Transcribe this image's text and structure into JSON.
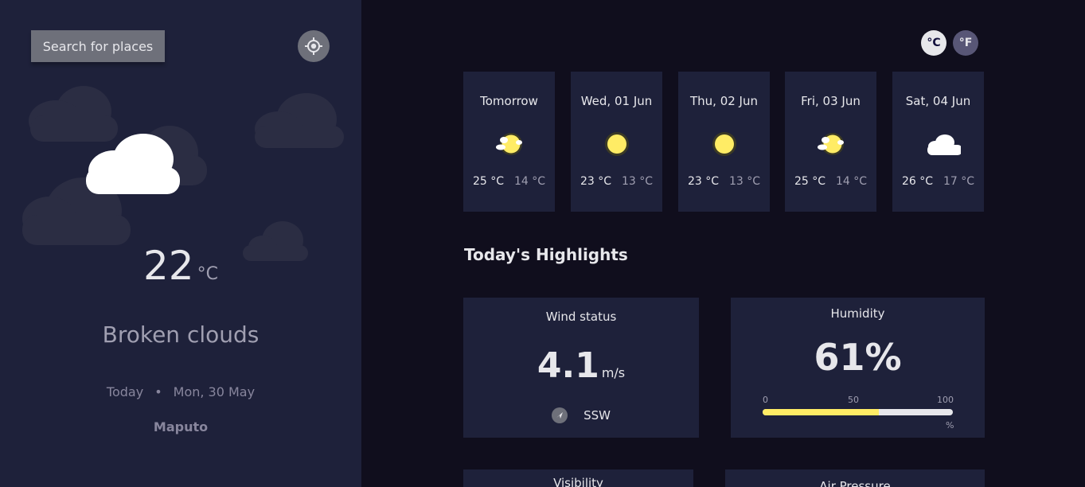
{
  "sidebar": {
    "search_label": "Search for places",
    "temperature": "22",
    "temperature_unit": "°C",
    "condition": "Broken clouds",
    "day_label": "Today",
    "separator": "•",
    "date": "Mon, 30 May",
    "location": "Maputo"
  },
  "units": {
    "celsius": "°C",
    "fahrenheit": "°F"
  },
  "forecast": [
    {
      "day": "Tomorrow",
      "max": "25 °C",
      "min": "14 °C",
      "icon": "sun-cloud-icon"
    },
    {
      "day": "Wed, 01 Jun",
      "max": "23 °C",
      "min": "13 °C",
      "icon": "sun-icon"
    },
    {
      "day": "Thu, 02 Jun",
      "max": "23 °C",
      "min": "13 °C",
      "icon": "sun-icon"
    },
    {
      "day": "Fri, 03 Jun",
      "max": "25 °C",
      "min": "14 °C",
      "icon": "sun-cloud-icon"
    },
    {
      "day": "Sat, 04 Jun",
      "max": "26 °C",
      "min": "17 °C",
      "icon": "cloud-icon"
    }
  ],
  "highlights": {
    "title": "Today's Highlights",
    "wind": {
      "label": "Wind status",
      "value": "4.1",
      "unit": "m/s",
      "direction": "SSW"
    },
    "humidity": {
      "label": "Humidity",
      "value": "61%",
      "percent": 61,
      "scale_min": "0",
      "scale_mid": "50",
      "scale_max": "100",
      "scale_unit": "%"
    },
    "visibility": {
      "label": "Visibility"
    },
    "air_pressure": {
      "label": "Air Pressure"
    }
  },
  "colors": {
    "sidebar_bg": "#1e213a",
    "page_bg": "#100e1d",
    "accent_yellow": "#ffec65",
    "button_grey": "#6e707a"
  }
}
